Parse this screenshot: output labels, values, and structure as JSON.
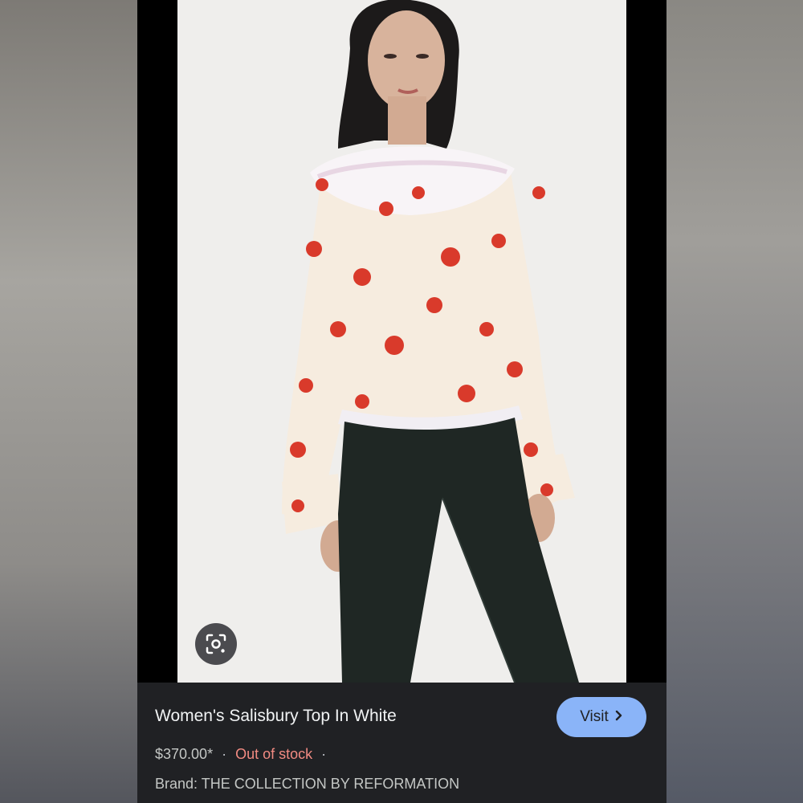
{
  "product": {
    "title": "Women's Salisbury Top In White",
    "price": "$370.00*",
    "separator_1": "·",
    "stock_status": "Out of stock",
    "separator_2": "·",
    "brand": "Brand: THE COLLECTION BY REFORMATION"
  },
  "actions": {
    "visit_label": "Visit"
  },
  "icons": {
    "lens": "google-lens-icon",
    "visit_chevron": "chevron-right-icon"
  },
  "colors": {
    "info_background": "#202124",
    "visit_button": "#8ab4f8",
    "out_of_stock": "#f28b82",
    "title_text": "#f1f3f4",
    "meta_text": "#c4c7c5"
  }
}
